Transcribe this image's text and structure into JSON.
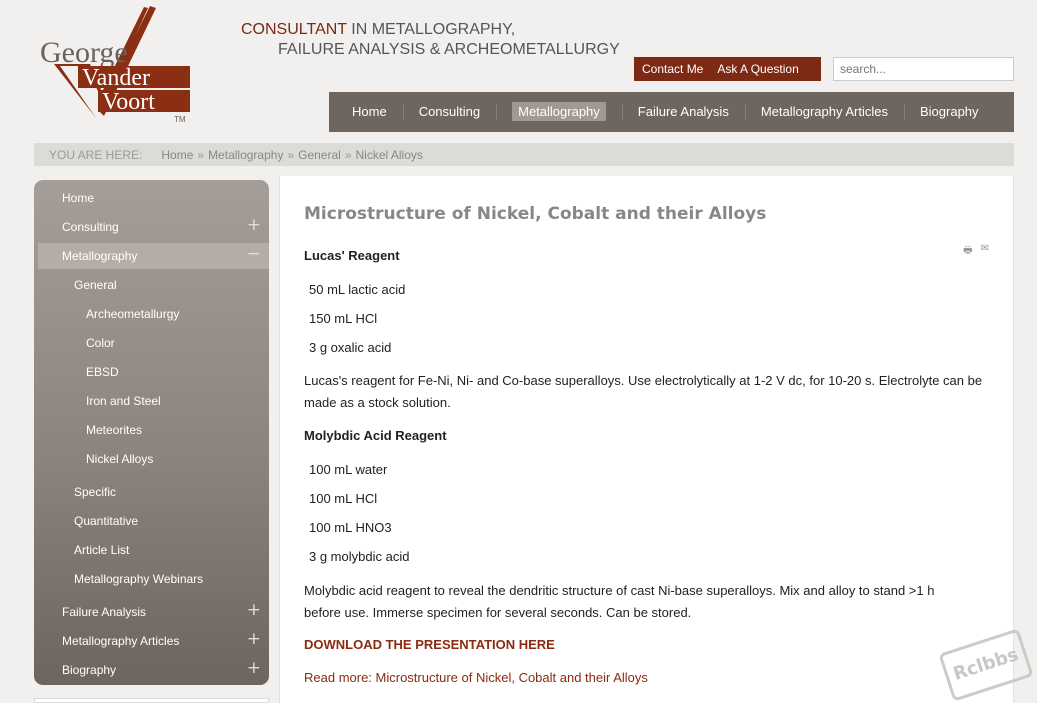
{
  "logo": {
    "line1": "George",
    "line2": "Vander",
    "line3": "Voort",
    "tm": "TM"
  },
  "tagline": {
    "accent": "CONSULTANT",
    "line1_rest": " IN METALLOGRAPHY,",
    "line2": "FAILURE ANALYSIS & ARCHEOMETALLURGY"
  },
  "top_buttons": {
    "contact": "Contact Me",
    "ask": "Ask A Question"
  },
  "search": {
    "placeholder": "search..."
  },
  "nav": {
    "items": [
      "Home",
      "Consulting",
      "Metallography",
      "Failure Analysis",
      "Metallography Articles",
      "Biography"
    ],
    "active": "Metallography"
  },
  "breadcrumb": {
    "label": "YOU ARE HERE:",
    "items": [
      "Home",
      "Metallography",
      "General",
      "Nickel Alloys"
    ],
    "separator": "»"
  },
  "sidebar": {
    "items": [
      {
        "label": "Home",
        "expand": ""
      },
      {
        "label": "Consulting",
        "expand": "+"
      },
      {
        "label": "Metallography",
        "expand": "−"
      },
      {
        "label": "General",
        "expand": ""
      },
      {
        "label": "Archeometallurgy",
        "expand": ""
      },
      {
        "label": "Color",
        "expand": ""
      },
      {
        "label": "EBSD",
        "expand": ""
      },
      {
        "label": "Iron and Steel",
        "expand": ""
      },
      {
        "label": "Meteorites",
        "expand": ""
      },
      {
        "label": "Nickel Alloys",
        "expand": ""
      },
      {
        "label": "Specific",
        "expand": ""
      },
      {
        "label": "Quantitative",
        "expand": ""
      },
      {
        "label": "Article List",
        "expand": ""
      },
      {
        "label": "Metallography Webinars",
        "expand": ""
      },
      {
        "label": "Failure Analysis",
        "expand": "+"
      },
      {
        "label": "Metallography Articles",
        "expand": "+"
      },
      {
        "label": "Biography",
        "expand": "+"
      }
    ]
  },
  "article": {
    "title": "Microstructure of Nickel, Cobalt and their Alloys",
    "tools": {
      "print": "🖶",
      "email": "✉"
    },
    "h1": "Lucas' Reagent",
    "lucas": [
      "50 mL lactic acid",
      "150 mL HCl",
      "3 g oxalic acid"
    ],
    "p1": "Lucas's reagent for Fe-Ni, Ni- and Co-base superalloys. Use electrolytically at 1-2 V dc, for 10-20 s. Electrolyte can be made as a stock solution.",
    "h2": "Molybdic Acid Reagent",
    "moly": [
      "100 mL water",
      "100 mL HCl",
      "100 mL HNO3",
      "3 g molybdic acid"
    ],
    "p2": "Molybdic acid reagent to reveal the dendritic structure of cast Ni-base superalloys. Mix and alloy to stand >1 h before use. Immerse specimen for several seconds. Can be stored.",
    "download": "DOWNLOAD THE PRESENTATION HERE",
    "readmore": "Read more: Microstructure of Nickel, Cobalt and their Alloys"
  },
  "watermark": "Rclbbs",
  "colors": {
    "brand": "#7d2a14",
    "nav_bg": "#6e655f",
    "link": "#8b2a10"
  }
}
